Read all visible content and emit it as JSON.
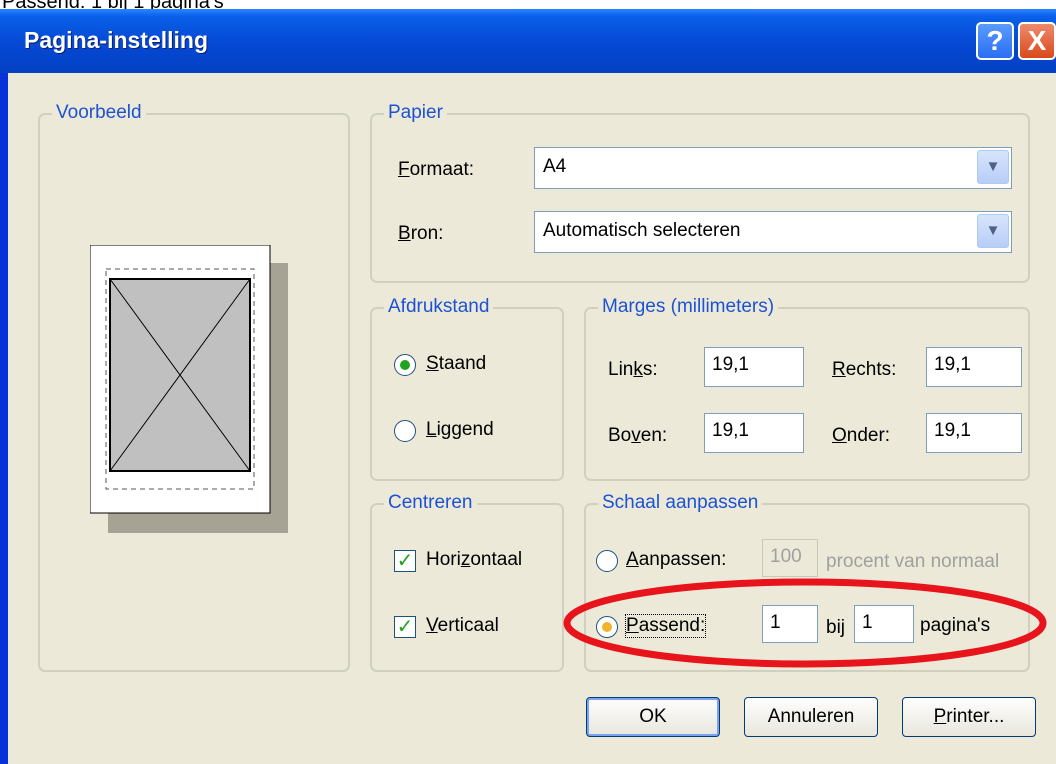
{
  "caption": "Passend: 1 bij 1 pagina's",
  "window": {
    "title": "Pagina-instelling",
    "help_label": "?",
    "close_label": "X"
  },
  "preview": {
    "legend": "Voorbeeld"
  },
  "paper": {
    "legend": "Papier",
    "format_label": "Formaat:",
    "format_value": "A4",
    "source_label": "Bron:",
    "source_value": "Automatisch selecteren"
  },
  "orientation": {
    "legend": "Afdrukstand",
    "portrait_label": "Staand",
    "portrait_selected": true,
    "landscape_label": "Liggend",
    "landscape_selected": false
  },
  "margins": {
    "legend": "Marges (millimeters)",
    "left_label": "Links:",
    "left_value": "19,1",
    "right_label": "Rechts:",
    "right_value": "19,1",
    "top_label": "Boven:",
    "top_value": "19,1",
    "bottom_label": "Onder:",
    "bottom_value": "19,1"
  },
  "center": {
    "legend": "Centreren",
    "horizontal_label": "Horizontaal",
    "horizontal_checked": true,
    "vertical_label": "Verticaal",
    "vertical_checked": true
  },
  "scale": {
    "legend": "Schaal aanpassen",
    "adjust_label": "Aanpassen:",
    "adjust_value": "100",
    "adjust_suffix": "procent van normaal",
    "fit_label": "Passend:",
    "fit_wide": "1",
    "fit_by": "bij",
    "fit_tall": "1",
    "fit_suffix": "pagina's"
  },
  "buttons": {
    "ok": "OK",
    "cancel": "Annuleren",
    "printer": "Printer..."
  },
  "colors": {
    "titlebar": "#0548d4",
    "dialog_bg": "#ece9d8",
    "legend_text": "#1c52d4",
    "highlight": "#e8141c"
  },
  "icons": {
    "help": "question-icon",
    "close": "close-x-icon",
    "dropdown": "chevron-down-icon"
  }
}
